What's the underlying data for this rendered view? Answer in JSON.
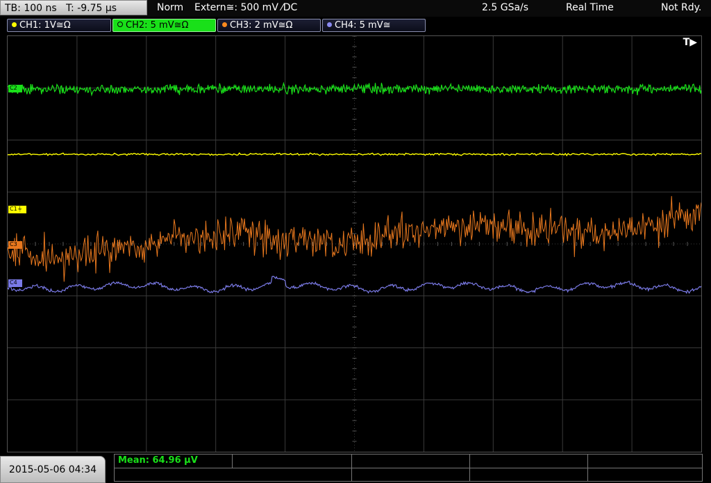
{
  "header": {
    "timebase": "TB: 100 ns   T: -9.75 µs",
    "mode": "Norm",
    "trigger": "Extern≅: 500 mV ⁄DC",
    "sample_rate": "2.5 GSa/s",
    "acq_mode": "Real Time",
    "status": "Not Rdy."
  },
  "channels": [
    {
      "label": "CH1: 1V≅Ω",
      "color": "#ffff00",
      "active": false
    },
    {
      "label": "CH2: 5 mV≅Ω",
      "color": "#19e019",
      "active": true
    },
    {
      "label": "CH3: 2 mV≅Ω",
      "color": "#ff8a1e",
      "active": false
    },
    {
      "label": "CH4: 5 mV≅",
      "color": "#8a8af0",
      "active": false
    }
  ],
  "trigger_marker": "T▶",
  "channel_markers": {
    "c1": "C1⏚",
    "c2": "C2",
    "c3": "C3",
    "c4": "C4"
  },
  "measurement": {
    "label": "Mean: 64.96 µV"
  },
  "timestamp": "2015-05-06 04:34",
  "colors": {
    "ch1": "#ffff00",
    "ch2": "#19e019",
    "ch3": "#e8781e",
    "ch4": "#7a7ae6",
    "grid": "#3a3a3a"
  }
}
